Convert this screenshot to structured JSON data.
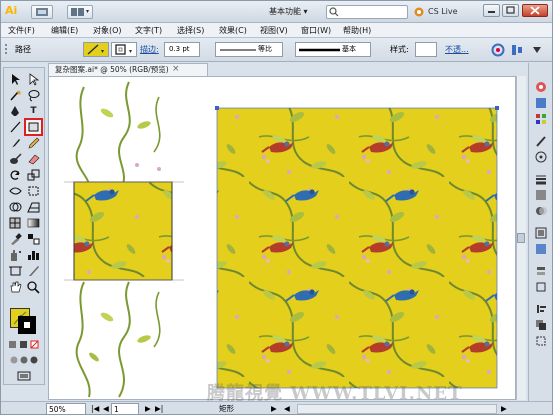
{
  "app": {
    "logo": "Ai",
    "workspace_label": "基本功能 ▾",
    "cs_live": "CS Live"
  },
  "menu": {
    "items": [
      "文件(F)",
      "编辑(E)",
      "对象(O)",
      "文字(T)",
      "选择(S)",
      "效果(C)",
      "视图(V)",
      "窗口(W)",
      "帮助(H)"
    ]
  },
  "controlbar": {
    "type_label": "路径",
    "stroke_label": "描边:",
    "stroke_value": "0.3 pt",
    "profile_label": "等比",
    "brush_label": "基本",
    "style_label": "样式:",
    "opacity_label": "不透..."
  },
  "document": {
    "tab_title": "复杂图案.ai* @ 50% (RGB/预览)"
  },
  "status": {
    "zoom": "50%",
    "artboard": "1",
    "tool_name": "矩形"
  },
  "watermark": "腾龍視覺 WWW.TLVI.NET",
  "colors": {
    "pattern_bg": "#e4cf1c",
    "vine": "#6f8a2e",
    "leaf": "#b8c94a",
    "bird_blue": "#2f6db0",
    "bird_red": "#b33d2a",
    "flower": "#d9a6c8",
    "highlight_tool": "#e02020"
  }
}
